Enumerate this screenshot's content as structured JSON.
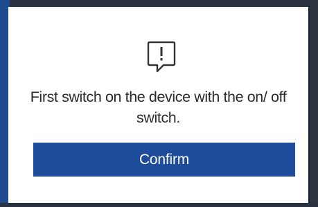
{
  "dialog": {
    "icon": "speech-bubble-exclamation-icon",
    "message": "First switch on the device with the on/ off switch.",
    "confirm_label": "Confirm"
  },
  "colors": {
    "button": "#1d4d9a",
    "icon_stroke": "#333333",
    "text": "#2b2b2b"
  }
}
